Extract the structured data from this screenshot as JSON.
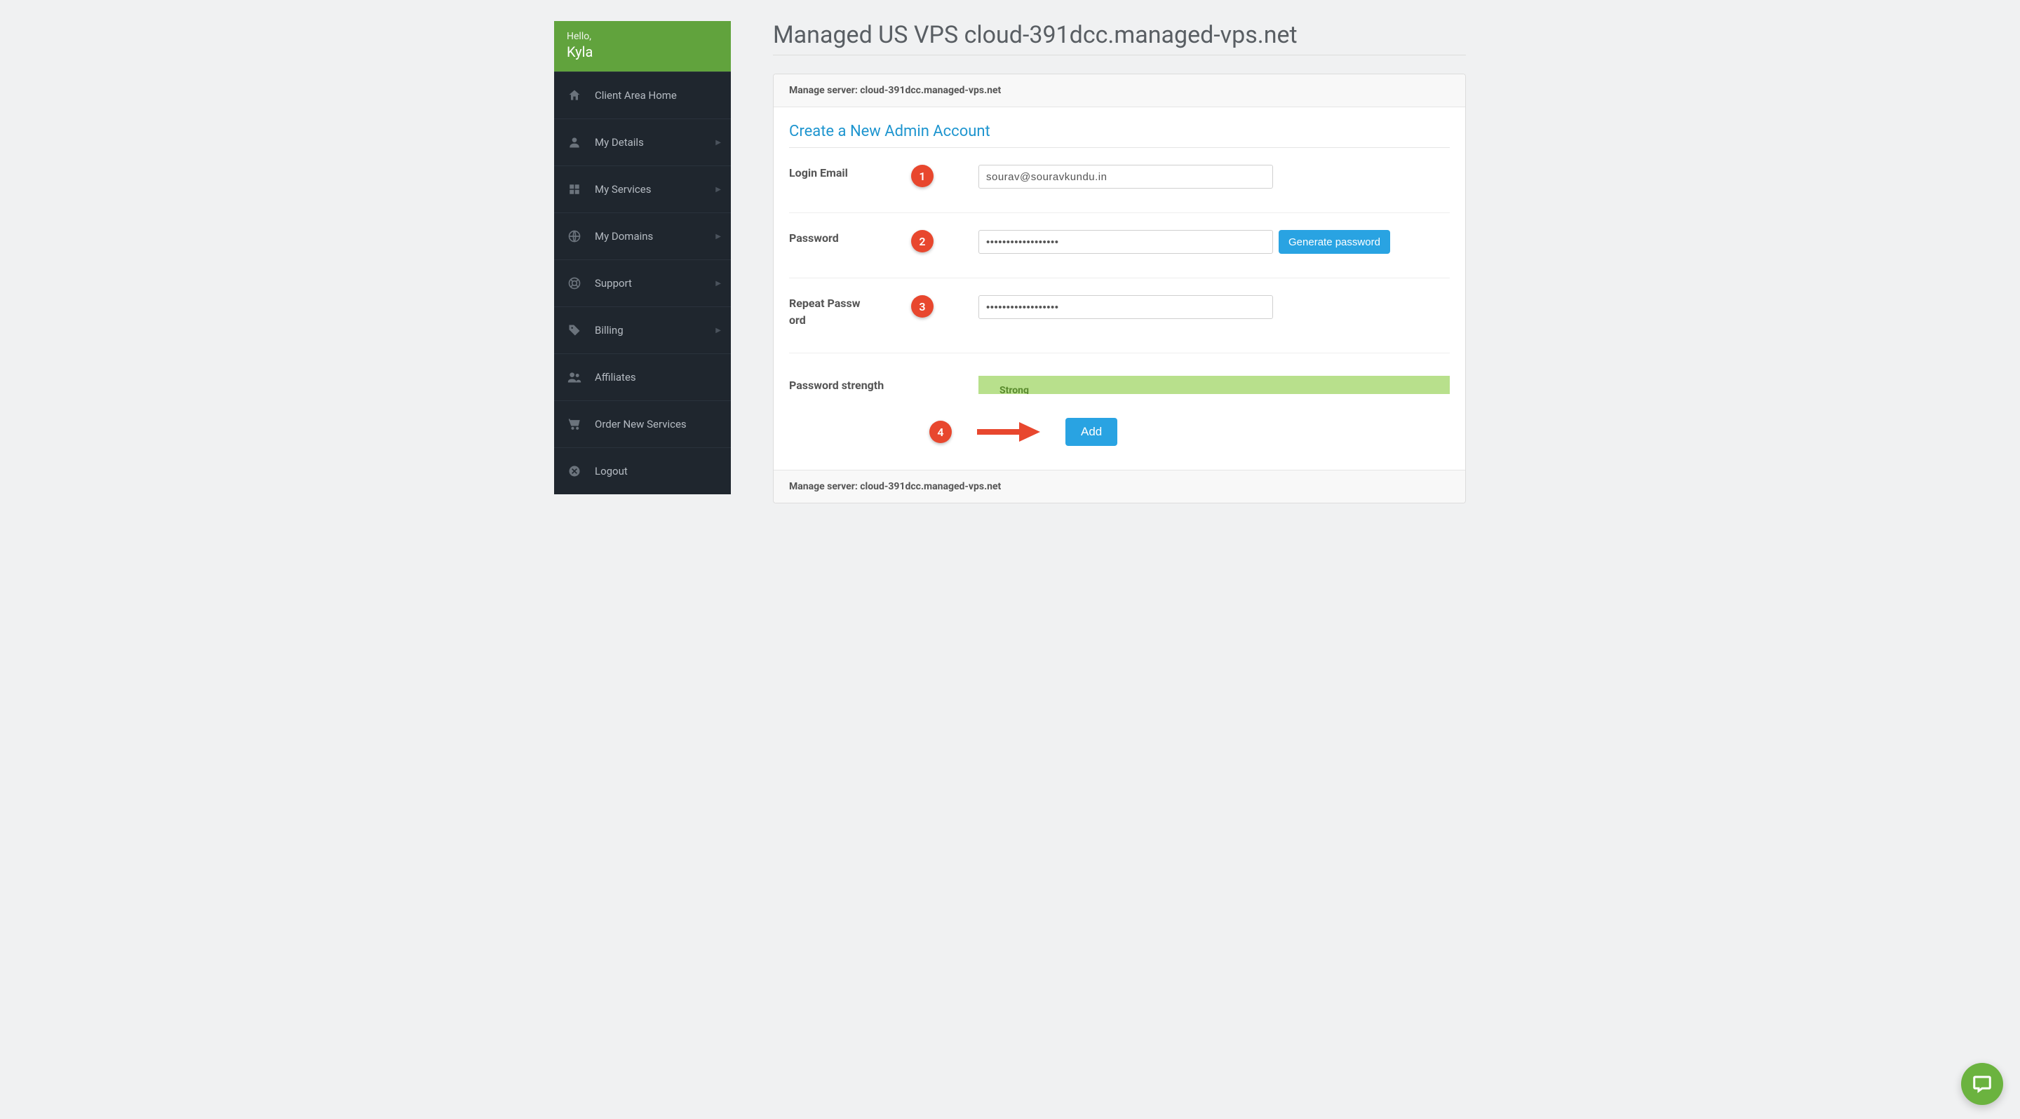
{
  "sidebar": {
    "greeting": "Hello,",
    "username": "Kyla",
    "items": [
      {
        "label": "Client Area Home",
        "icon": "home-icon",
        "expandable": false
      },
      {
        "label": "My Details",
        "icon": "user-icon",
        "expandable": true
      },
      {
        "label": "My Services",
        "icon": "grid-icon",
        "expandable": true
      },
      {
        "label": "My Domains",
        "icon": "globe-icon",
        "expandable": true
      },
      {
        "label": "Support",
        "icon": "lifebuoy-icon",
        "expandable": true
      },
      {
        "label": "Billing",
        "icon": "tag-icon",
        "expandable": true
      },
      {
        "label": "Affiliates",
        "icon": "people-icon",
        "expandable": false
      },
      {
        "label": "Order New Services",
        "icon": "cart-icon",
        "expandable": false
      },
      {
        "label": "Logout",
        "icon": "close-circle-icon",
        "expandable": false
      }
    ]
  },
  "page": {
    "title": "Managed US VPS cloud-391dcc.managed-vps.net"
  },
  "panel": {
    "header_prefix": "Manage server: ",
    "server_name": "cloud-391dcc.managed-vps.net",
    "section_title": "Create a New Admin Account",
    "footer_prefix": "Manage server: "
  },
  "form": {
    "login_label": "Login Email",
    "login_value": "sourav@souravkundu.in",
    "password_label": "Password",
    "password_value": "••••••••••••••••••",
    "generate_label": "Generate password",
    "repeat_label": "Repeat Password",
    "repeat_value": "••••••••••••••••••",
    "strength_label": "Password strength",
    "strength_value": "Strong",
    "submit_label": "Add"
  },
  "annotations": {
    "step1": "1",
    "step2": "2",
    "step3": "3",
    "step4": "4"
  },
  "colors": {
    "accent_green": "#61a33d",
    "link_blue": "#1e95cf",
    "btn_blue": "#29a3e2",
    "badge_red": "#e8472e"
  }
}
